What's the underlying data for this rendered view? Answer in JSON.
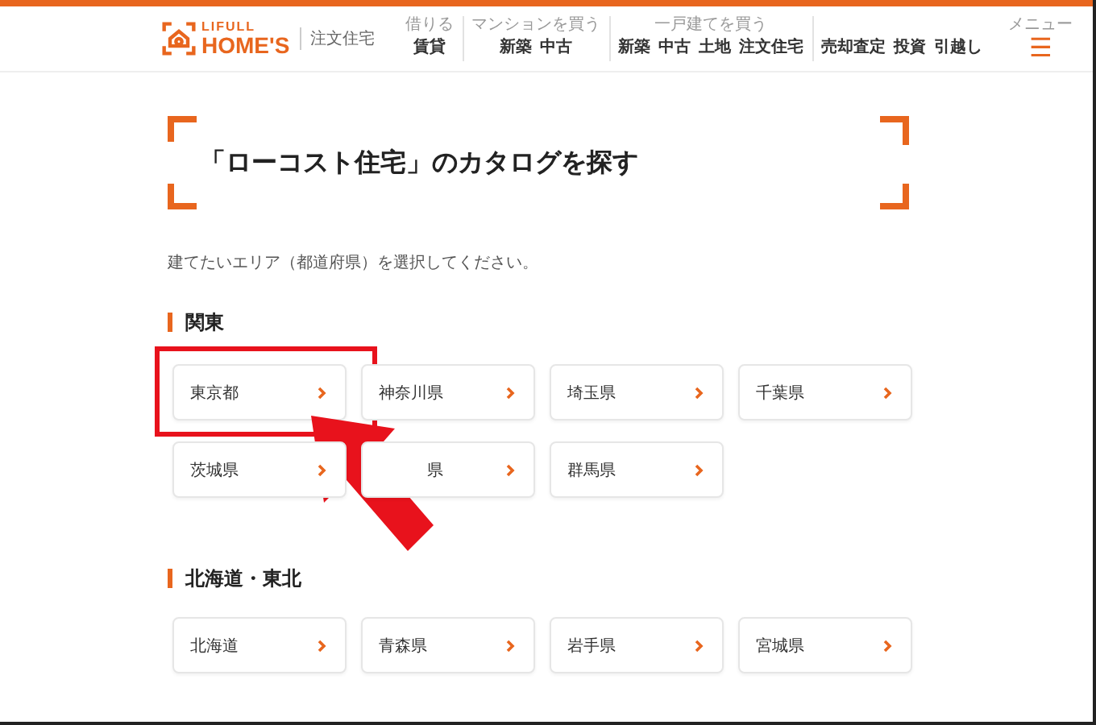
{
  "header": {
    "logo": {
      "line1": "LIFULL",
      "line2": "HOME'S"
    },
    "section_label": "注文住宅",
    "nav_groups": [
      {
        "caption": "借りる",
        "links": [
          "賃貸"
        ]
      },
      {
        "caption": "マンションを買う",
        "links": [
          "新築",
          "中古"
        ]
      },
      {
        "caption": "一戸建てを買う",
        "links": [
          "新築",
          "中古",
          "土地",
          "注文住宅"
        ]
      },
      {
        "links": [
          "売却査定",
          "投資",
          "引越し"
        ]
      }
    ],
    "menu": {
      "caption": "メニュー",
      "icon": "☰"
    }
  },
  "title": "「ローコスト住宅」のカタログを探す",
  "instruction": "建てたいエリア（都道府県）を選択してください。",
  "regions": [
    {
      "name": "関東",
      "prefectures": [
        {
          "name": "東京都",
          "highlighted": true
        },
        {
          "name": "神奈川県",
          "highlighted": false
        },
        {
          "name": "埼玉県",
          "highlighted": false
        },
        {
          "name": "千葉県",
          "highlighted": false
        },
        {
          "name": "茨城県",
          "highlighted": false
        },
        {
          "name": "県",
          "highlighted": false
        },
        {
          "name": "群馬県",
          "highlighted": false
        }
      ]
    },
    {
      "name": "北海道・東北",
      "prefectures": [
        {
          "name": "北海道",
          "highlighted": false
        },
        {
          "name": "青森県",
          "highlighted": false
        },
        {
          "name": "岩手県",
          "highlighted": false
        },
        {
          "name": "宮城県",
          "highlighted": false
        }
      ]
    }
  ]
}
